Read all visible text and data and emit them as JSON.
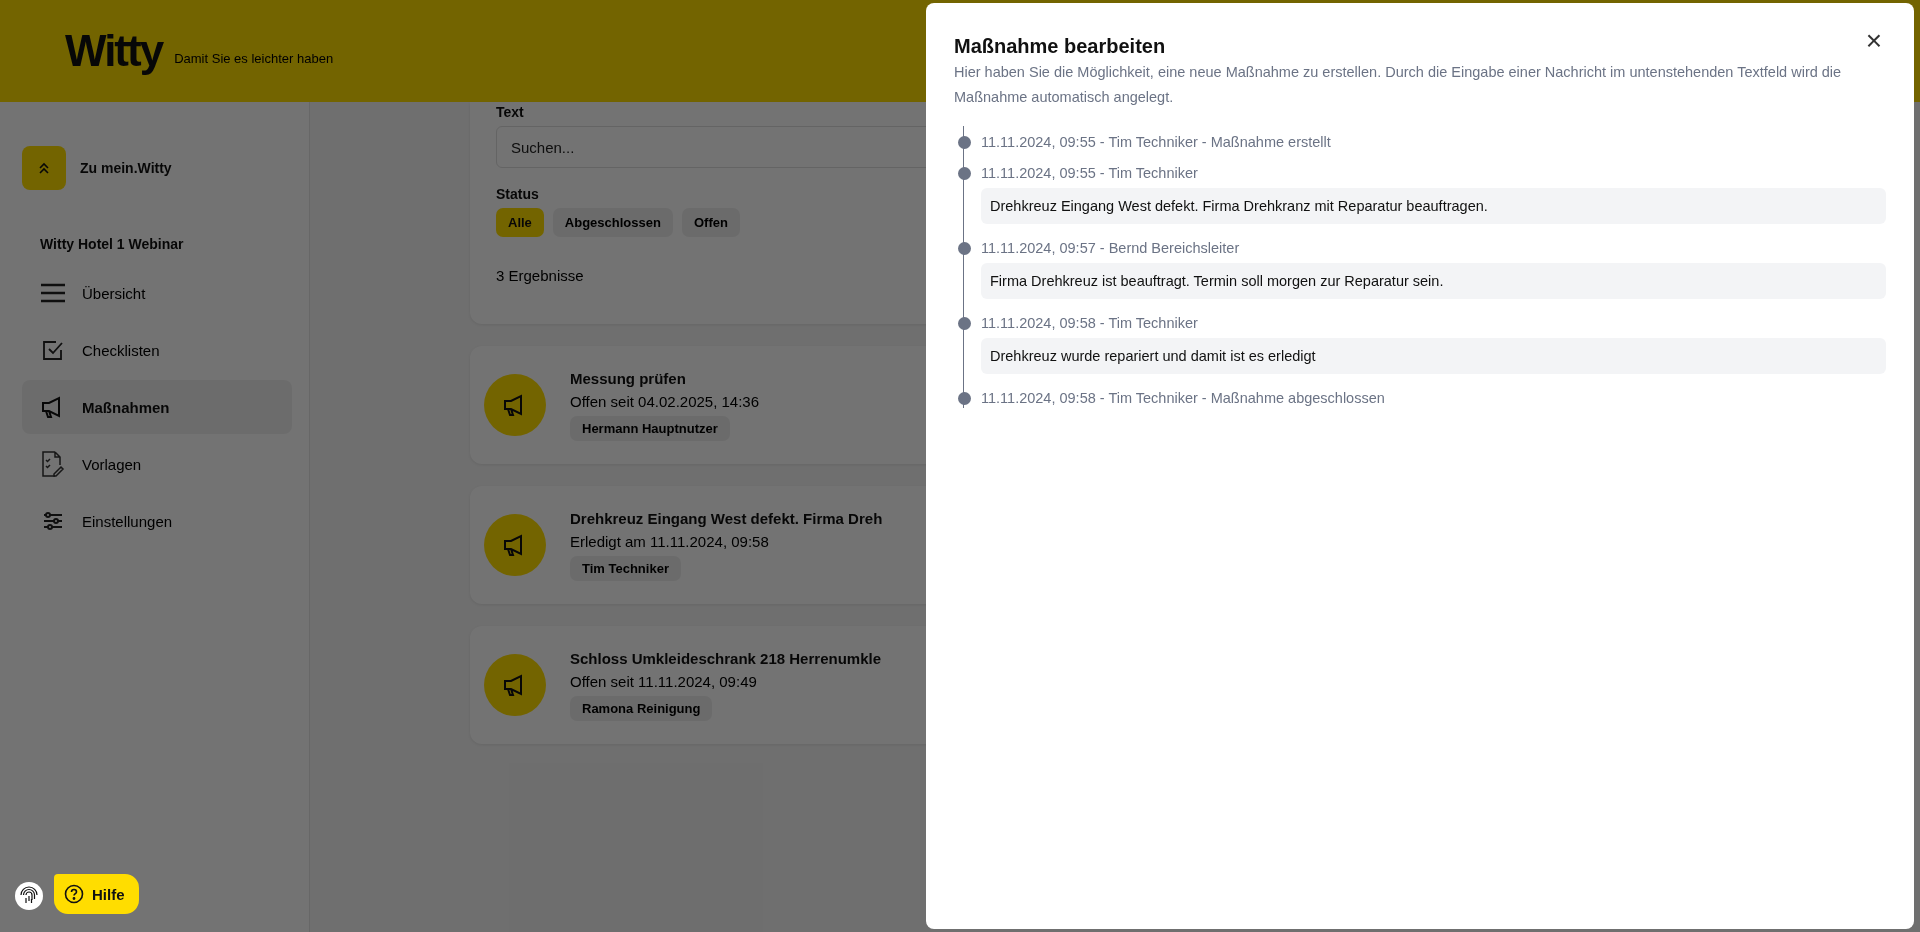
{
  "header": {
    "logo": "Witty",
    "tagline": "Damit Sie es leichter haben"
  },
  "sidebar": {
    "back_button": "Zu mein.Witty",
    "section": "Witty Hotel 1 Webinar",
    "items": [
      {
        "label": "Übersicht",
        "selected": false
      },
      {
        "label": "Checklisten",
        "selected": false
      },
      {
        "label": "Maßnahmen",
        "selected": true
      },
      {
        "label": "Vorlagen",
        "selected": false
      },
      {
        "label": "Einstellungen",
        "selected": false
      }
    ]
  },
  "filter": {
    "text_label": "Text",
    "search": {
      "placeholder": "Suchen..."
    },
    "status_label": "Status",
    "statuses": [
      {
        "label": "Alle",
        "selected": true
      },
      {
        "label": "Abgeschlossen",
        "selected": false
      },
      {
        "label": "Offen",
        "selected": false
      }
    ],
    "result_count": "3 Ergebnisse"
  },
  "cards": [
    {
      "title": "Messung prüfen",
      "status": "Offen seit 04.02.2025, 14:36",
      "person": "Hermann Hauptnutzer"
    },
    {
      "title": "Drehkreuz Eingang West defekt. Firma Dreh",
      "status": "Erledigt am 11.11.2024, 09:58",
      "person": "Tim Techniker"
    },
    {
      "title": "Schloss Umkleideschrank 218 Herrenumkle",
      "status": "Offen seit 11.11.2024, 09:49",
      "person": "Ramona Reinigung"
    }
  ],
  "help_button": "Hilfe",
  "drawer": {
    "title": "Maßnahme bearbeiten",
    "close": "×",
    "description": "Hier haben Sie die Möglichkeit, eine neue Maßnahme zu erstellen. Durch die Eingabe einer Nachricht im untenstehenden Textfeld wird die Maßnahme automatisch angelegt.",
    "timeline": [
      {
        "meta": "11.11.2024, 09:55 - Tim Techniker - Maßnahme erstellt"
      },
      {
        "meta": "11.11.2024, 09:55 - Tim Techniker",
        "message": "Drehkreuz Eingang West defekt. Firma Drehkranz mit Reparatur beauftragen."
      },
      {
        "meta": "11.11.2024, 09:57 - Bernd Bereichsleiter",
        "message": "Firma Drehkreuz ist beauftragt. Termin soll morgen zur Reparatur sein."
      },
      {
        "meta": "11.11.2024, 09:58 - Tim Techniker",
        "message": "Drehkreuz wurde repariert und damit ist es erledigt"
      },
      {
        "meta": "11.11.2024, 09:58 - Tim Techniker - Maßnahme abgeschlossen"
      }
    ]
  }
}
